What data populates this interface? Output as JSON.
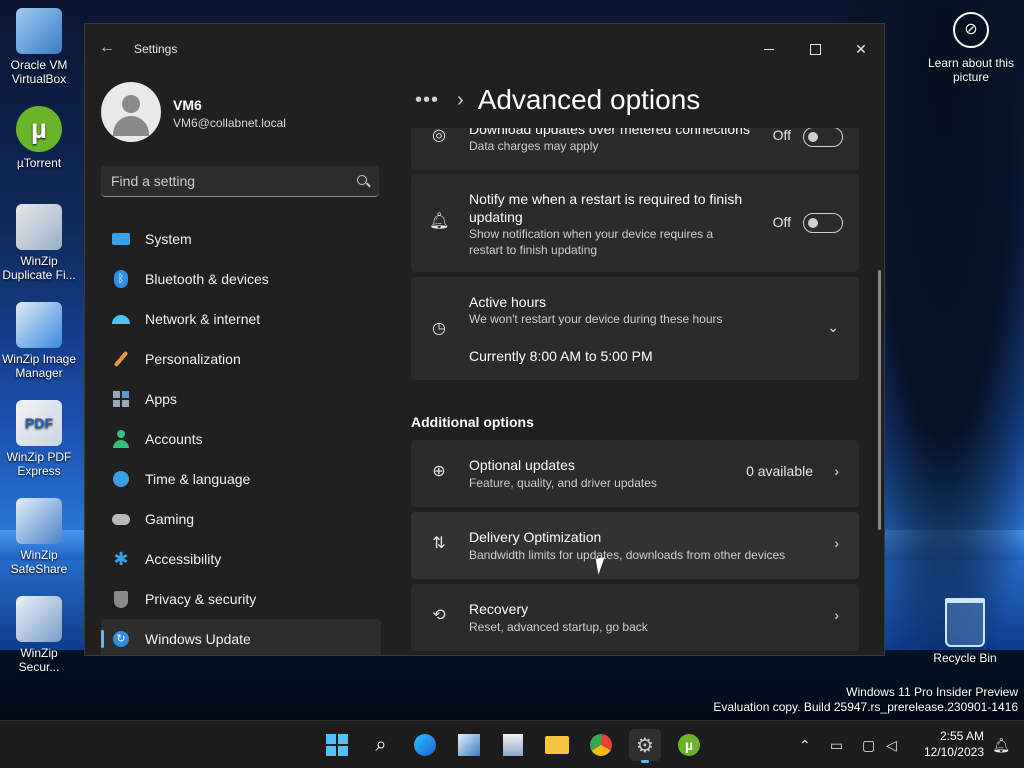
{
  "desktop": {
    "icons": [
      {
        "label": "Oracle VM VirtualBox"
      },
      {
        "label": "µTorrent"
      },
      {
        "label": "WinZip Duplicate Fi..."
      },
      {
        "label": "WinZip Image Manager"
      },
      {
        "label": "WinZip PDF Express"
      },
      {
        "label": "WinZip SafeShare"
      },
      {
        "label": "WinZip Secur..."
      }
    ],
    "learn_about": "Learn about this picture",
    "recycle_bin": "Recycle Bin",
    "watermark_line1": "Windows 11 Pro Insider Preview",
    "watermark_line2": "Evaluation copy. Build 25947.rs_prerelease.230901-1416"
  },
  "window": {
    "title": "Settings",
    "user_name": "VM6",
    "user_email": "VM6@collabnet.local",
    "search_placeholder": "Find a setting",
    "nav": [
      {
        "label": "System",
        "icon": "monitor-icon",
        "color": "#3aa0e8"
      },
      {
        "label": "Bluetooth & devices",
        "icon": "bluetooth-icon",
        "color": "#2f8fe6"
      },
      {
        "label": "Network & internet",
        "icon": "wifi-icon",
        "color": "#4cc2ff"
      },
      {
        "label": "Personalization",
        "icon": "brush-icon",
        "color": "#e89a3a"
      },
      {
        "label": "Apps",
        "icon": "apps-icon",
        "color": "#9aa6b8"
      },
      {
        "label": "Accounts",
        "icon": "person-icon",
        "color": "#2ec27e"
      },
      {
        "label": "Time & language",
        "icon": "globe-clock-icon",
        "color": "#3aa0e8"
      },
      {
        "label": "Gaming",
        "icon": "controller-icon",
        "color": "#b8b8b8"
      },
      {
        "label": "Accessibility",
        "icon": "accessibility-icon",
        "color": "#3aa0e8"
      },
      {
        "label": "Privacy & security",
        "icon": "shield-icon",
        "color": "#8a8a8a"
      },
      {
        "label": "Windows Update",
        "icon": "update-icon",
        "color": "#2f8fe6"
      }
    ],
    "active_nav": "Windows Update",
    "page_title": "Advanced options",
    "cards": {
      "metered_title": "Download updates over metered connections",
      "metered_sub": "Data charges may apply",
      "metered_state": "Off",
      "notify_title": "Notify me when a restart is required to finish updating",
      "notify_sub": "Show notification when your device requires a restart to finish updating",
      "notify_state": "Off",
      "active_title": "Active hours",
      "active_sub": "We won't restart your device during these hours",
      "active_current": "Currently 8:00 AM to 5:00 PM"
    },
    "section_title": "Additional options",
    "additional": [
      {
        "title": "Optional updates",
        "sub": "Feature, quality, and driver updates",
        "value": "0 available"
      },
      {
        "title": "Delivery Optimization",
        "sub": "Bandwidth limits for updates, downloads from other devices",
        "value": ""
      },
      {
        "title": "Recovery",
        "sub": "Reset, advanced startup, go back",
        "value": ""
      }
    ]
  },
  "taskbar": {
    "time": "2:55 AM",
    "date": "12/10/2023"
  },
  "colors": {
    "accent": "#4cc2ff",
    "window_bg": "#202020",
    "card_bg": "#2b2b2b"
  }
}
